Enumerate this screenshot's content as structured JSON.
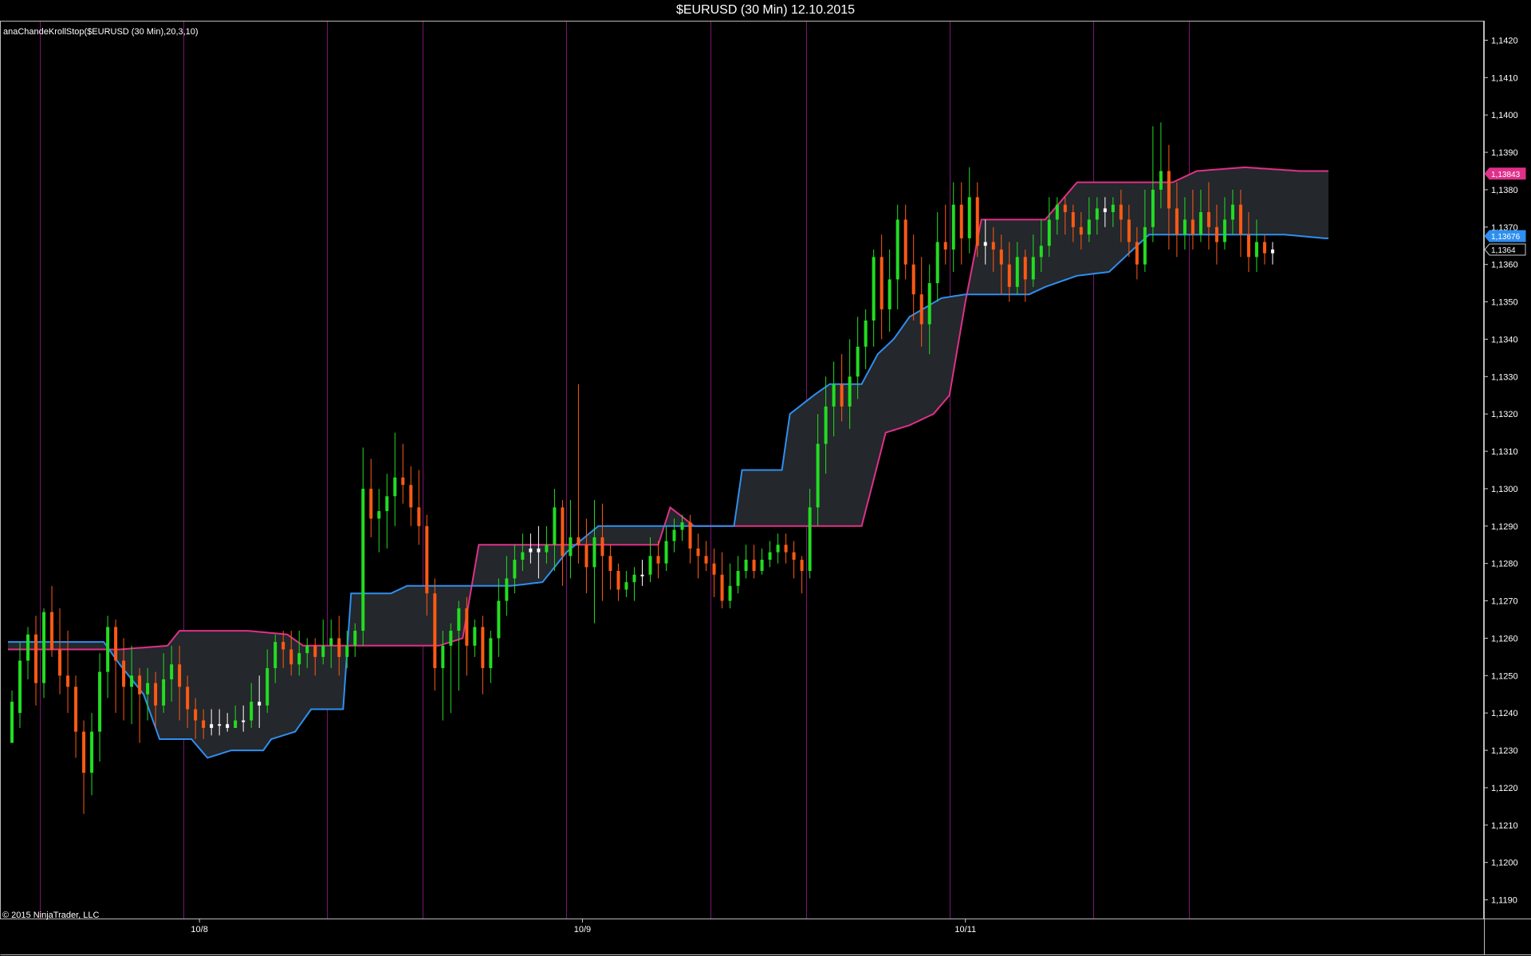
{
  "window": {
    "title": "$EURUSD (30 Min)  12.10.2015"
  },
  "indicator_label": "anaChandeKrollStop($EURUSD (30 Min),20,3,10)",
  "copyright": "© 2015 NinjaTrader, LLC",
  "colors": {
    "background": "#000000",
    "up_candle": "#22dd22",
    "down_candle": "#ff5a14",
    "doji": "#ffffff",
    "upper_stop": "#e0308a",
    "lower_stop": "#2e8ff0",
    "cloud_fill": "#24272b",
    "session_line": "#7a1670",
    "axis": "#cccccc"
  },
  "chart_data": {
    "type": "candlestick",
    "title": "$EURUSD (30 Min)  12.10.2015",
    "ylim": [
      1.1185,
      1.1425
    ],
    "y_ticks": [
      "1,1190",
      "1,1200",
      "1,1210",
      "1,1220",
      "1,1230",
      "1,1240",
      "1,1250",
      "1,1260",
      "1,1270",
      "1,1280",
      "1,1290",
      "1,1300",
      "1,1310",
      "1,1320",
      "1,1330",
      "1,1340",
      "1,1350",
      "1,1360",
      "1,1370",
      "1,1380",
      "1,1390",
      "1,1400",
      "1,1410",
      "1,1420"
    ],
    "x_ticks": [
      {
        "label": "10/8",
        "bar": 48
      },
      {
        "label": "10/9",
        "bar": 144
      },
      {
        "label": "10/11",
        "bar": 240
      }
    ],
    "session_breaks": [
      8,
      44,
      80,
      104,
      140,
      176,
      200,
      236,
      272,
      296
    ],
    "price_badges": [
      {
        "label": "1,13843",
        "value": 1.13843,
        "color": "#e0308a"
      },
      {
        "label": "1,13676",
        "value": 1.13676,
        "color": "#2e8ff0"
      },
      {
        "label": "1,1364",
        "value": 1.1364,
        "color": "#000000"
      }
    ],
    "bars_count": 332,
    "upper_stop": [
      [
        0,
        1.1257
      ],
      [
        26,
        1.1257
      ],
      [
        28,
        1.1257
      ],
      [
        40,
        1.1258
      ],
      [
        43,
        1.1262
      ],
      [
        48,
        1.1262
      ],
      [
        60,
        1.1262
      ],
      [
        70,
        1.1261
      ],
      [
        74,
        1.1258
      ],
      [
        108,
        1.1258
      ],
      [
        114,
        1.126
      ],
      [
        118,
        1.1285
      ],
      [
        138,
        1.1285
      ],
      [
        163,
        1.1285
      ],
      [
        166,
        1.1295
      ],
      [
        172,
        1.129
      ],
      [
        214,
        1.129
      ],
      [
        220,
        1.1315
      ],
      [
        226,
        1.1317
      ],
      [
        232,
        1.132
      ],
      [
        236,
        1.1325
      ],
      [
        240,
        1.135
      ],
      [
        244,
        1.1372
      ],
      [
        260,
        1.1372
      ],
      [
        268,
        1.1382
      ],
      [
        292,
        1.1382
      ],
      [
        298,
        1.1385
      ],
      [
        310,
        1.1386
      ],
      [
        324,
        1.1385
      ],
      [
        332,
        1.1385
      ]
    ],
    "lower_stop": [
      [
        0,
        1.1259
      ],
      [
        24,
        1.1259
      ],
      [
        28,
        1.1253
      ],
      [
        34,
        1.1245
      ],
      [
        38,
        1.1233
      ],
      [
        46,
        1.1233
      ],
      [
        50,
        1.1228
      ],
      [
        56,
        1.123
      ],
      [
        64,
        1.123
      ],
      [
        66,
        1.1233
      ],
      [
        72,
        1.1235
      ],
      [
        76,
        1.1241
      ],
      [
        84,
        1.1241
      ],
      [
        86,
        1.1272
      ],
      [
        96,
        1.1272
      ],
      [
        100,
        1.1274
      ],
      [
        114,
        1.1274
      ],
      [
        118,
        1.1274
      ],
      [
        126,
        1.1274
      ],
      [
        134,
        1.1275
      ],
      [
        140,
        1.1283
      ],
      [
        148,
        1.129
      ],
      [
        166,
        1.129
      ],
      [
        174,
        1.129
      ],
      [
        182,
        1.129
      ],
      [
        184,
        1.1305
      ],
      [
        194,
        1.1305
      ],
      [
        196,
        1.132
      ],
      [
        202,
        1.1325
      ],
      [
        206,
        1.1328
      ],
      [
        214,
        1.1328
      ],
      [
        218,
        1.1336
      ],
      [
        222,
        1.134
      ],
      [
        226,
        1.1346
      ],
      [
        234,
        1.1351
      ],
      [
        240,
        1.1352
      ],
      [
        250,
        1.1352
      ],
      [
        256,
        1.1352
      ],
      [
        260,
        1.1354
      ],
      [
        268,
        1.1357
      ],
      [
        276,
        1.1358
      ],
      [
        280,
        1.1362
      ],
      [
        286,
        1.1368
      ],
      [
        300,
        1.1368
      ],
      [
        320,
        1.1368
      ],
      [
        330,
        1.1367
      ],
      [
        332,
        1.1367
      ]
    ],
    "candles": [
      [
        1.1232,
        1.1243,
        1.124,
        1.1246
      ],
      [
        1.124,
        1.1254,
        1.1236,
        1.1259
      ],
      [
        1.1254,
        1.1261,
        1.1249,
        1.1263
      ],
      [
        1.1261,
        1.1248,
        1.1242,
        1.1266
      ],
      [
        1.1248,
        1.1267,
        1.1244,
        1.1268
      ],
      [
        1.1267,
        1.1257,
        1.1255,
        1.1274
      ],
      [
        1.1257,
        1.125,
        1.1245,
        1.1268
      ],
      [
        1.125,
        1.1247,
        1.124,
        1.1262
      ],
      [
        1.1247,
        1.1235,
        1.1228,
        1.125
      ],
      [
        1.1235,
        1.1224,
        1.1213,
        1.1238
      ],
      [
        1.1224,
        1.1235,
        1.1218,
        1.124
      ],
      [
        1.1235,
        1.1251,
        1.1227,
        1.1256
      ],
      [
        1.1251,
        1.1263,
        1.1244,
        1.1266
      ],
      [
        1.1263,
        1.1254,
        1.124,
        1.1265
      ],
      [
        1.1254,
        1.1247,
        1.1238,
        1.126
      ],
      [
        1.1247,
        1.125,
        1.1237,
        1.1258
      ],
      [
        1.125,
        1.1245,
        1.1232,
        1.1252
      ],
      [
        1.1245,
        1.1248,
        1.1238,
        1.1252
      ],
      [
        1.1248,
        1.1242,
        1.1236,
        1.1251
      ],
      [
        1.1242,
        1.1249,
        1.124,
        1.1256
      ],
      [
        1.1249,
        1.1253,
        1.1243,
        1.1258
      ],
      [
        1.1253,
        1.1247,
        1.1238,
        1.1258
      ],
      [
        1.1247,
        1.1241,
        1.1236,
        1.125
      ],
      [
        1.1241,
        1.1238,
        1.1233,
        1.1244
      ],
      [
        1.1238,
        1.1236,
        1.1233,
        1.1241
      ],
      [
        1.1236,
        1.1237,
        1.1234,
        1.1241
      ],
      [
        1.1237,
        1.1237,
        1.1234,
        1.1241
      ],
      [
        1.1237,
        1.1236,
        1.1235,
        1.124
      ],
      [
        1.1236,
        1.1238,
        1.1236,
        1.1242
      ],
      [
        1.1238,
        1.1238,
        1.1235,
        1.1242
      ],
      [
        1.1238,
        1.1243,
        1.1236,
        1.1248
      ],
      [
        1.1243,
        1.1242,
        1.1236,
        1.125
      ],
      [
        1.1242,
        1.1252,
        1.124,
        1.1257
      ],
      [
        1.1252,
        1.1259,
        1.1248,
        1.1261
      ],
      [
        1.1259,
        1.1257,
        1.1252,
        1.1262
      ],
      [
        1.1257,
        1.1253,
        1.125,
        1.1262
      ],
      [
        1.1253,
        1.1256,
        1.125,
        1.1262
      ],
      [
        1.1256,
        1.1258,
        1.1252,
        1.126
      ],
      [
        1.1258,
        1.1255,
        1.125,
        1.126
      ],
      [
        1.1255,
        1.1258,
        1.1253,
        1.1265
      ],
      [
        1.1258,
        1.126,
        1.1252,
        1.1265
      ],
      [
        1.126,
        1.1255,
        1.125,
        1.1266
      ],
      [
        1.1255,
        1.1258,
        1.1252,
        1.1262
      ],
      [
        1.1258,
        1.1262,
        1.1255,
        1.1264
      ],
      [
        1.1262,
        1.13,
        1.1258,
        1.1311
      ],
      [
        1.13,
        1.1292,
        1.1287,
        1.1308
      ],
      [
        1.1292,
        1.1294,
        1.1283,
        1.13
      ],
      [
        1.1294,
        1.1298,
        1.1284,
        1.1304
      ],
      [
        1.1298,
        1.1303,
        1.129,
        1.1315
      ],
      [
        1.1303,
        1.1301,
        1.1296,
        1.1312
      ],
      [
        1.1301,
        1.1295,
        1.129,
        1.1306
      ],
      [
        1.1295,
        1.129,
        1.1285,
        1.1305
      ],
      [
        1.129,
        1.1272,
        1.1266,
        1.1293
      ],
      [
        1.1272,
        1.1252,
        1.1246,
        1.1276
      ],
      [
        1.1252,
        1.1258,
        1.1238,
        1.1262
      ],
      [
        1.1258,
        1.1262,
        1.124,
        1.1264
      ],
      [
        1.1262,
        1.1268,
        1.1246,
        1.127
      ],
      [
        1.1268,
        1.1258,
        1.125,
        1.1271
      ],
      [
        1.1258,
        1.1263,
        1.1255,
        1.1265
      ],
      [
        1.1263,
        1.1252,
        1.1245,
        1.1266
      ],
      [
        1.1252,
        1.126,
        1.1248,
        1.1262
      ],
      [
        1.126,
        1.127,
        1.1255,
        1.1276
      ],
      [
        1.127,
        1.1276,
        1.1266,
        1.1282
      ],
      [
        1.1276,
        1.1281,
        1.1272,
        1.1285
      ],
      [
        1.1281,
        1.1283,
        1.1278,
        1.1288
      ],
      [
        1.1283,
        1.1284,
        1.128,
        1.1288
      ],
      [
        1.1284,
        1.1283,
        1.1276,
        1.129
      ],
      [
        1.1283,
        1.1285,
        1.128,
        1.129
      ],
      [
        1.1285,
        1.1295,
        1.1278,
        1.13
      ],
      [
        1.1295,
        1.1282,
        1.1274,
        1.1297
      ],
      [
        1.1282,
        1.1287,
        1.1276,
        1.1297
      ],
      [
        1.1287,
        1.1285,
        1.128,
        1.1328
      ],
      [
        1.1285,
        1.1279,
        1.1272,
        1.1292
      ],
      [
        1.1279,
        1.1287,
        1.1264,
        1.1297
      ],
      [
        1.1287,
        1.1282,
        1.127,
        1.1296
      ],
      [
        1.1282,
        1.1278,
        1.1273,
        1.1285
      ],
      [
        1.1278,
        1.1273,
        1.127,
        1.128
      ],
      [
        1.1273,
        1.1275,
        1.1271,
        1.1278
      ],
      [
        1.1275,
        1.1277,
        1.127,
        1.1279
      ],
      [
        1.1277,
        1.1277,
        1.1274,
        1.1281
      ],
      [
        1.1277,
        1.1282,
        1.1275,
        1.1287
      ],
      [
        1.1282,
        1.128,
        1.1276,
        1.1286
      ],
      [
        1.128,
        1.1286,
        1.1278,
        1.129
      ],
      [
        1.1286,
        1.1289,
        1.1283,
        1.1292
      ],
      [
        1.1289,
        1.1291,
        1.1286,
        1.1293
      ],
      [
        1.1291,
        1.1284,
        1.128,
        1.1293
      ],
      [
        1.1284,
        1.1282,
        1.1276,
        1.1288
      ],
      [
        1.1282,
        1.128,
        1.1278,
        1.1286
      ],
      [
        1.128,
        1.1277,
        1.1271,
        1.1284
      ],
      [
        1.1277,
        1.127,
        1.1268,
        1.1283
      ],
      [
        1.127,
        1.1274,
        1.1268,
        1.128
      ],
      [
        1.1274,
        1.1278,
        1.1272,
        1.1282
      ],
      [
        1.1278,
        1.1281,
        1.1276,
        1.1285
      ],
      [
        1.1281,
        1.1278,
        1.1276,
        1.1285
      ],
      [
        1.1278,
        1.1281,
        1.1277,
        1.1284
      ],
      [
        1.1281,
        1.1283,
        1.1279,
        1.1286
      ],
      [
        1.1283,
        1.1285,
        1.128,
        1.1288
      ],
      [
        1.1285,
        1.1283,
        1.128,
        1.1288
      ],
      [
        1.1283,
        1.1281,
        1.1276,
        1.1286
      ],
      [
        1.1281,
        1.1278,
        1.1272,
        1.1282
      ],
      [
        1.1278,
        1.1295,
        1.1276,
        1.13
      ],
      [
        1.1295,
        1.1312,
        1.129,
        1.132
      ],
      [
        1.1312,
        1.1322,
        1.1304,
        1.133
      ],
      [
        1.1322,
        1.1328,
        1.1314,
        1.1334
      ],
      [
        1.1328,
        1.1322,
        1.1318,
        1.1336
      ],
      [
        1.1322,
        1.133,
        1.1316,
        1.134
      ],
      [
        1.133,
        1.1338,
        1.1324,
        1.1346
      ],
      [
        1.1338,
        1.1345,
        1.1332,
        1.1348
      ],
      [
        1.1345,
        1.1362,
        1.1338,
        1.1364
      ],
      [
        1.1362,
        1.1348,
        1.134,
        1.1368
      ],
      [
        1.1348,
        1.1356,
        1.1342,
        1.1364
      ],
      [
        1.1356,
        1.1372,
        1.1348,
        1.1376
      ],
      [
        1.1372,
        1.136,
        1.1356,
        1.1376
      ],
      [
        1.136,
        1.1352,
        1.1345,
        1.1368
      ],
      [
        1.1352,
        1.1344,
        1.1338,
        1.1362
      ],
      [
        1.1344,
        1.1355,
        1.1336,
        1.136
      ],
      [
        1.1355,
        1.1366,
        1.135,
        1.1374
      ],
      [
        1.1366,
        1.1364,
        1.136,
        1.1376
      ],
      [
        1.1364,
        1.1376,
        1.1358,
        1.1382
      ],
      [
        1.1376,
        1.1367,
        1.136,
        1.1382
      ],
      [
        1.1367,
        1.1378,
        1.1363,
        1.1386
      ],
      [
        1.1378,
        1.1365,
        1.1362,
        1.1382
      ],
      [
        1.1365,
        1.1366,
        1.136,
        1.1372
      ],
      [
        1.1366,
        1.1364,
        1.1358,
        1.137
      ],
      [
        1.1364,
        1.136,
        1.1352,
        1.1368
      ],
      [
        1.136,
        1.1354,
        1.135,
        1.1366
      ],
      [
        1.1354,
        1.1362,
        1.1352,
        1.1366
      ],
      [
        1.1362,
        1.1356,
        1.135,
        1.1364
      ],
      [
        1.1356,
        1.1362,
        1.1354,
        1.1368
      ],
      [
        1.1362,
        1.1365,
        1.1358,
        1.1372
      ],
      [
        1.1365,
        1.1372,
        1.1362,
        1.1378
      ],
      [
        1.1372,
        1.1376,
        1.1368,
        1.1378
      ],
      [
        1.1376,
        1.1374,
        1.1368,
        1.1378
      ],
      [
        1.1374,
        1.137,
        1.1366,
        1.1376
      ],
      [
        1.137,
        1.1368,
        1.1364,
        1.1374
      ],
      [
        1.1368,
        1.1372,
        1.1366,
        1.1378
      ],
      [
        1.1372,
        1.1375,
        1.1368,
        1.1378
      ],
      [
        1.1375,
        1.1374,
        1.137,
        1.1378
      ],
      [
        1.1374,
        1.1376,
        1.137,
        1.1378
      ],
      [
        1.1376,
        1.1372,
        1.1366,
        1.138
      ],
      [
        1.1372,
        1.1366,
        1.1362,
        1.1376
      ],
      [
        1.1366,
        1.136,
        1.1356,
        1.137
      ],
      [
        1.136,
        1.137,
        1.1358,
        1.138
      ],
      [
        1.137,
        1.138,
        1.1366,
        1.1397
      ],
      [
        1.138,
        1.1385,
        1.1375,
        1.1398
      ],
      [
        1.1385,
        1.1375,
        1.1364,
        1.1392
      ],
      [
        1.1375,
        1.1368,
        1.1362,
        1.1382
      ],
      [
        1.1368,
        1.1372,
        1.1364,
        1.1378
      ],
      [
        1.1372,
        1.1368,
        1.1364,
        1.138
      ],
      [
        1.1368,
        1.1374,
        1.1366,
        1.138
      ],
      [
        1.1374,
        1.137,
        1.1364,
        1.1382
      ],
      [
        1.137,
        1.1366,
        1.136,
        1.1376
      ],
      [
        1.1366,
        1.1372,
        1.1364,
        1.1378
      ],
      [
        1.1372,
        1.1376,
        1.1368,
        1.138
      ],
      [
        1.1376,
        1.1368,
        1.1362,
        1.138
      ],
      [
        1.1368,
        1.1362,
        1.1358,
        1.1374
      ],
      [
        1.1362,
        1.1366,
        1.1358,
        1.1372
      ],
      [
        1.1366,
        1.1363,
        1.136,
        1.1368
      ],
      [
        1.1363,
        1.1364,
        1.136,
        1.1366
      ]
    ]
  }
}
